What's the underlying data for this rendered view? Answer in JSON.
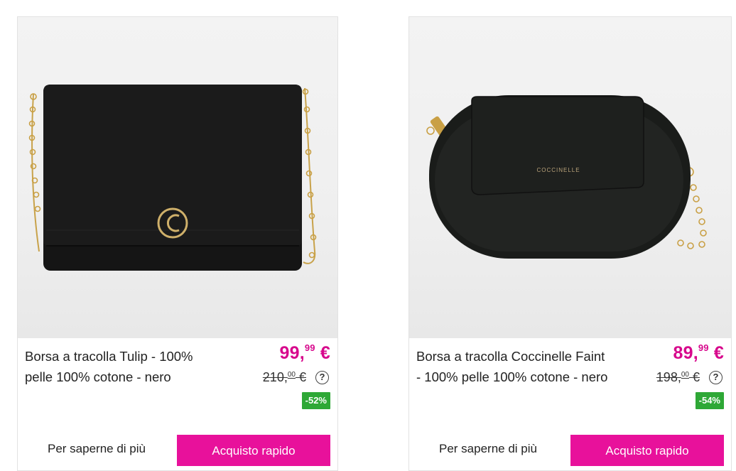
{
  "products": [
    {
      "title": "Borsa a tracolla Tulip - 100% pelle 100% cotone - nero",
      "price_int": "99,",
      "price_dec": "99",
      "price_cur": "€",
      "old_int": "210,",
      "old_dec": "00",
      "old_cur": "€",
      "help": "?",
      "discount": "-52%",
      "more_label": "Per saperne di più",
      "buy_label": "Acquisto rapido"
    },
    {
      "title": "Borsa a tracolla Coccinelle Faint - 100% pelle 100% cotone - nero",
      "price_int": "89,",
      "price_dec": "99",
      "price_cur": "€",
      "old_int": "198,",
      "old_dec": "00",
      "old_cur": "€",
      "help": "?",
      "discount": "-54%",
      "more_label": "Per saperne di più",
      "buy_label": "Acquisto rapido",
      "brand_stamp": "COCCINELLE"
    }
  ],
  "colors": {
    "price": "#d7088c",
    "buy_button": "#e8119b",
    "discount_badge": "#2ea836"
  }
}
